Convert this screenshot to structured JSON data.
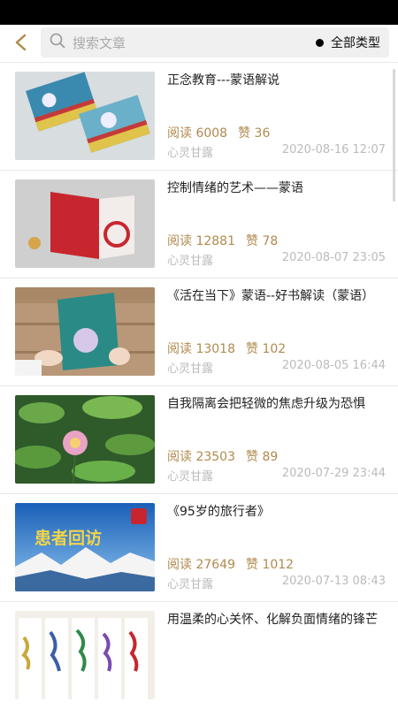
{
  "header": {
    "search_placeholder": "搜索文章",
    "filter_label": "全部类型"
  },
  "articles": [
    {
      "title": "正念教育---蒙语解说",
      "reads_label": "阅读 6008",
      "likes_label": "赞 36",
      "author": "心灵甘露",
      "date": "2020-08-16 12:07"
    },
    {
      "title": "控制情绪的艺术——蒙语",
      "reads_label": "阅读 12881",
      "likes_label": "赞 78",
      "author": "心灵甘露",
      "date": "2020-08-07 23:05"
    },
    {
      "title": "《活在当下》蒙语--好书解读（蒙语）",
      "reads_label": "阅读 13018",
      "likes_label": "赞 102",
      "author": "心灵甘露",
      "date": "2020-08-05 16:44"
    },
    {
      "title": "自我隔离会把轻微的焦虑升级为恐惧",
      "reads_label": "阅读 23503",
      "likes_label": "赞 89",
      "author": "心灵甘露",
      "date": "2020-07-29 23:44"
    },
    {
      "title": "《95岁的旅行者》",
      "reads_label": "阅读 27649",
      "likes_label": "赞 1012",
      "author": "心灵甘露",
      "date": "2020-07-13 08:43"
    },
    {
      "title": "用温柔的心关怀、化解负面情绪的锋芒",
      "reads_label": "",
      "likes_label": "",
      "author": "",
      "date": ""
    }
  ],
  "thumbnails": {
    "banner_text": "患者回访"
  },
  "colors": {
    "accent": "#b08a4e"
  },
  "icons": {
    "back": "back-arrow-icon",
    "search": "search-icon"
  }
}
